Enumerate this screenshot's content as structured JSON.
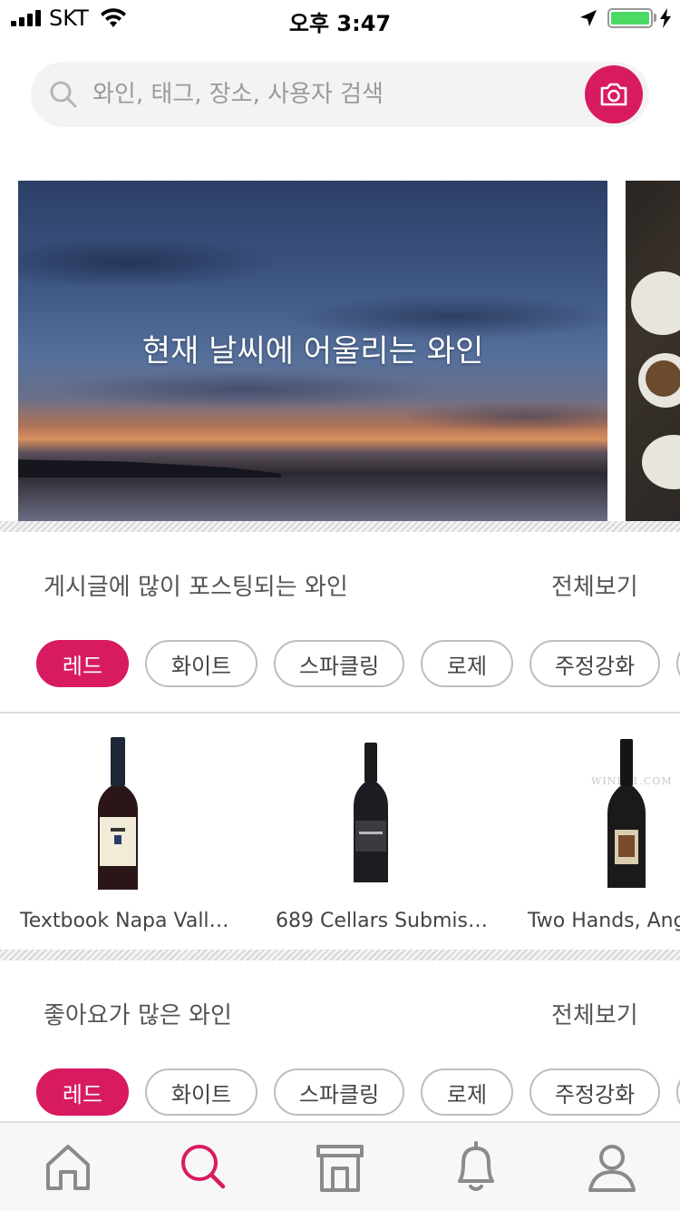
{
  "status_bar": {
    "carrier": "SKT",
    "time": "오후 3:47"
  },
  "search": {
    "placeholder": "와인, 태그, 장소, 사용자 검색"
  },
  "banners": [
    {
      "title": "현재 날씨에 어울리는 와인"
    }
  ],
  "sections": [
    {
      "title": "게시글에 많이 포스팅되는 와인",
      "see_all": "전체보기",
      "chips": [
        "레드",
        "화이트",
        "스파클링",
        "로제",
        "주정강화"
      ],
      "active_chip": "레드",
      "wines": [
        {
          "name": "Textbook Napa Vall…"
        },
        {
          "name": "689 Cellars Submis…"
        },
        {
          "name": "Two Hands, Ange"
        }
      ]
    },
    {
      "title": "좋아요가 많은 와인",
      "see_all": "전체보기",
      "chips": [
        "레드",
        "화이트",
        "스파클링",
        "로제",
        "주정강화"
      ],
      "active_chip": "레드"
    }
  ],
  "watermark": "WINE21.COM",
  "colors": {
    "accent": "#d81b60",
    "battery": "#4cd964",
    "icon_gray": "#8a8a8a"
  },
  "tabbar": {
    "active": "search",
    "tabs": [
      "home-icon",
      "search-icon",
      "store-icon",
      "bell-icon",
      "profile-icon"
    ]
  }
}
